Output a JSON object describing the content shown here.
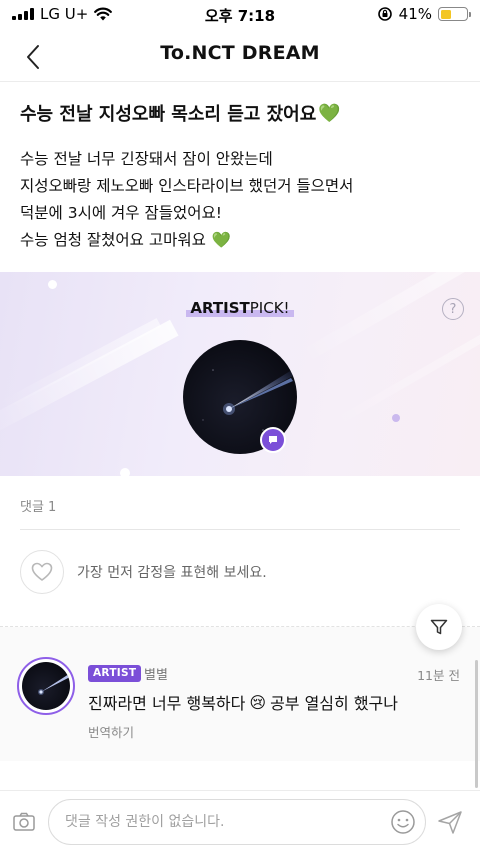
{
  "status_bar": {
    "carrier": "LG U+",
    "time": "오후 7:18",
    "battery_percent": "41%",
    "battery_level": 0.41
  },
  "nav": {
    "title": "To.NCT DREAM",
    "back_icon": "chevron-left-icon"
  },
  "post": {
    "title": "수능 전날 지성오빠 목소리 듣고 잤어요",
    "title_emoji": "💚",
    "body_lines": [
      "수능 전날 너무 긴장돼서 잠이 안왔는데",
      "지성오빠랑 제노오빠 인스타라이브 했던거 들으면서",
      "덕분에 3시에 겨우 잠들었어요!",
      "수능 엄청 잘쳤어요 고마워요"
    ],
    "body_last_emoji": "💚"
  },
  "artist_pick": {
    "label_bold": "ARTIST",
    "label_rest": " PICK!",
    "help_icon": "?"
  },
  "comments": {
    "count_label": "댓글 1",
    "reaction_hint": "가장 먼저 감정을 표현해 보세요.",
    "items": [
      {
        "badge": "ARTIST",
        "author": "별별",
        "time": "11분 전",
        "text": "진짜라면 너무 행복하다",
        "emoji": "😢",
        "text_after": "공부 열심히 했구나",
        "translate_label": "번역하기"
      }
    ]
  },
  "input": {
    "placeholder": "댓글 작성 권한이 없습니다."
  },
  "colors": {
    "accent": "#7b4fd8",
    "pick_highlight": "#c9b8f0",
    "battery": "#f3c623"
  }
}
